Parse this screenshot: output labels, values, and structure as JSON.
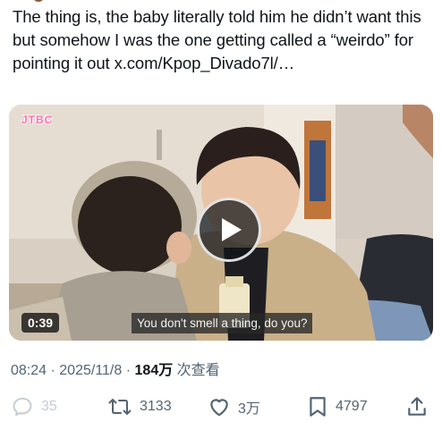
{
  "tweet": {
    "text_main": "The thing is, the baby literally told him he didn’t want this but somehow I was the one getting called a “weirdo” for pointing it out ",
    "text_link": "x.com/Kpop_Divado7l/…"
  },
  "video": {
    "duration": "0:39",
    "subtitle": "You don't smell a thing, do you?",
    "channel_logo_text": "JTBC"
  },
  "meta": {
    "time": "08:24",
    "date": "2025/11/8",
    "views_count": "184万",
    "views_label": "次查看",
    "separator": "·"
  },
  "actions": {
    "reply_count": "35",
    "retweet_count": "3133",
    "like_count": "3万",
    "bookmark_count": "4797"
  },
  "icons": {
    "reply": "reply-icon",
    "retweet": "retweet-icon",
    "like": "heart-icon",
    "bookmark": "bookmark-icon",
    "share": "share-icon",
    "play": "play-icon"
  }
}
